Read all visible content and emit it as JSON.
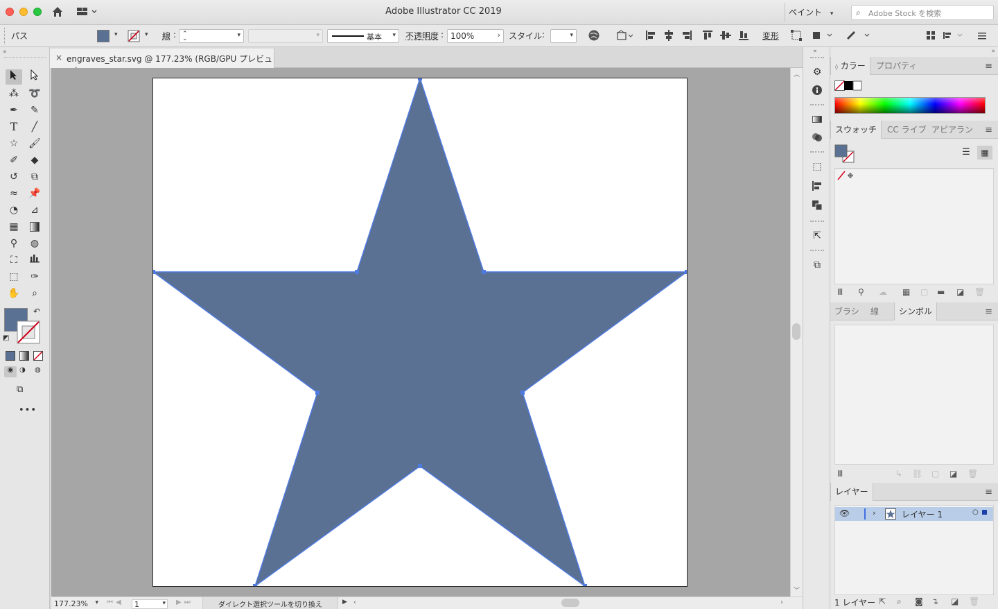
{
  "window": {
    "title": "Adobe Illustrator CC 2019",
    "workspace": "ペイント",
    "stock_search_placeholder": "Adobe Stock を検索"
  },
  "control_bar": {
    "selection_type": "パス",
    "stroke_label": "線",
    "stroke_profile": "基本",
    "opacity_label": "不透明度",
    "opacity_value": "100%",
    "style_label": "スタイル",
    "transform_label": "変形",
    "fill_color": "#5a7194"
  },
  "document": {
    "tab_title": "engraves_star.svg @ 177.23% (RGB/GPU プレビュー)",
    "star_fill": "#5a7194",
    "star_stroke": "#4f7ae0"
  },
  "status_bar": {
    "zoom": "177.23%",
    "artboard_number": "1",
    "status_text": "ダイレクト選択ツールを切り換え"
  },
  "panels": {
    "color_group": {
      "tabs": [
        "カラー",
        "プロパティ"
      ]
    },
    "swatch_group": {
      "tabs": [
        "スウォッチ",
        "CC ライブ",
        "アピアラン"
      ]
    },
    "brush_group": {
      "tabs": [
        "ブラシ",
        "線",
        "シンボル"
      ]
    },
    "layers_group": {
      "tabs": [
        "レイヤー"
      ],
      "layer_name": "レイヤー 1",
      "footer_count": "1 レイヤー"
    }
  },
  "icons": [
    "home-icon",
    "workspace-grid-icon",
    "search-icon",
    "globe-icon",
    "align-icon",
    "selection-tool-icon",
    "direct-selection-icon",
    "pen-icon",
    "type-icon",
    "star-tool-icon",
    "hand-icon",
    "zoom-icon",
    "eye-icon",
    "menu-icon"
  ]
}
